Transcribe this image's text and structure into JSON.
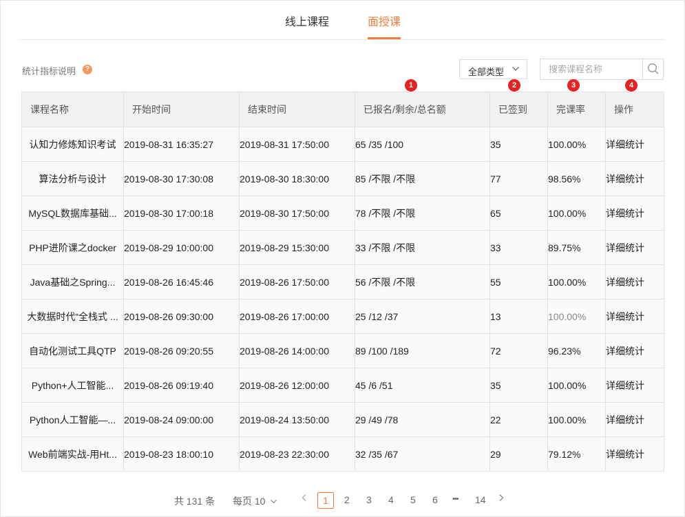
{
  "tabs": {
    "online": "线上课程",
    "offline": "面授课"
  },
  "toolbar": {
    "stat_help": "统计指标说明",
    "help_icon": "?",
    "type_select": "全部类型",
    "search_placeholder": "搜索课程名称"
  },
  "markers": [
    "1",
    "2",
    "3",
    "4"
  ],
  "table": {
    "headers": [
      "课程名称",
      "开始时间",
      "结束时间",
      "已报名/剩余/总名额",
      "已签到",
      "完课率",
      "操作"
    ],
    "rows": [
      {
        "name": "认知力修炼知识考试",
        "start": "2019-08-31 16:35:27",
        "end": "2019-08-31 17:50:00",
        "quota": "65 /35 /100",
        "signed": "35",
        "rate": "100.00%",
        "op": "详细统计"
      },
      {
        "name": "算法分析与设计",
        "start": "2019-08-30 17:30:08",
        "end": "2019-08-30 18:30:00",
        "quota": "85 /不限 /不限",
        "signed": "77",
        "rate": "98.56%",
        "op": "详细统计"
      },
      {
        "name": "MySQL数据库基础...",
        "start": "2019-08-30 17:00:18",
        "end": "2019-08-30 17:50:00",
        "quota": "78 /不限 /不限",
        "signed": "65",
        "rate": "100.00%",
        "op": "详细统计"
      },
      {
        "name": "PHP进阶课之docker",
        "start": "2019-08-29 10:00:00",
        "end": "2019-08-29 15:30:00",
        "quota": "33 /不限 /不限",
        "signed": "33",
        "rate": "89.75%",
        "op": "详细统计"
      },
      {
        "name": "Java基础之Spring...",
        "start": "2019-08-26 16:45:46",
        "end": "2019-08-26 17:50:00",
        "quota": "56 /不限 /不限",
        "signed": "55",
        "rate": "100.00%",
        "op": "详细统计"
      },
      {
        "name": "大数据时代“全栈式 ...",
        "start": "2019-08-26 09:30:00",
        "end": "2019-08-26 17:00:00",
        "quota": "25 /12 /37",
        "signed": "13",
        "rate": "100.00%",
        "op": "详细统计"
      },
      {
        "name": "自动化测试工具QTP",
        "start": "2019-08-26 09:20:55",
        "end": "2019-08-26 14:00:00",
        "quota": "89 /100 /189",
        "signed": "72",
        "rate": "96.23%",
        "op": "详细统计"
      },
      {
        "name": "Python+人工智能...",
        "start": "2019-08-26 09:19:40",
        "end": "2019-08-26 12:00:00",
        "quota": "45 /6 /51",
        "signed": "35",
        "rate": "100.00%",
        "op": "详细统计"
      },
      {
        "name": "Python人工智能—...",
        "start": "2019-08-24 09:00:00",
        "end": "2019-08-24 13:50:00",
        "quota": "29 /49 /78",
        "signed": "22",
        "rate": "100.00%",
        "op": "详细统计"
      },
      {
        "name": "Web前端实战-用Ht...",
        "start": "2019-08-23 18:00:10",
        "end": "2019-08-23 22:30:00",
        "quota": "32 /35 /67",
        "signed": "29",
        "rate": "79.12%",
        "op": "详细统计"
      }
    ]
  },
  "pagination": {
    "total": "共 131 条",
    "per_page": "每页 10",
    "pages": [
      "1",
      "2",
      "3",
      "4",
      "5",
      "6",
      "•••",
      "14"
    ],
    "current": "1"
  }
}
